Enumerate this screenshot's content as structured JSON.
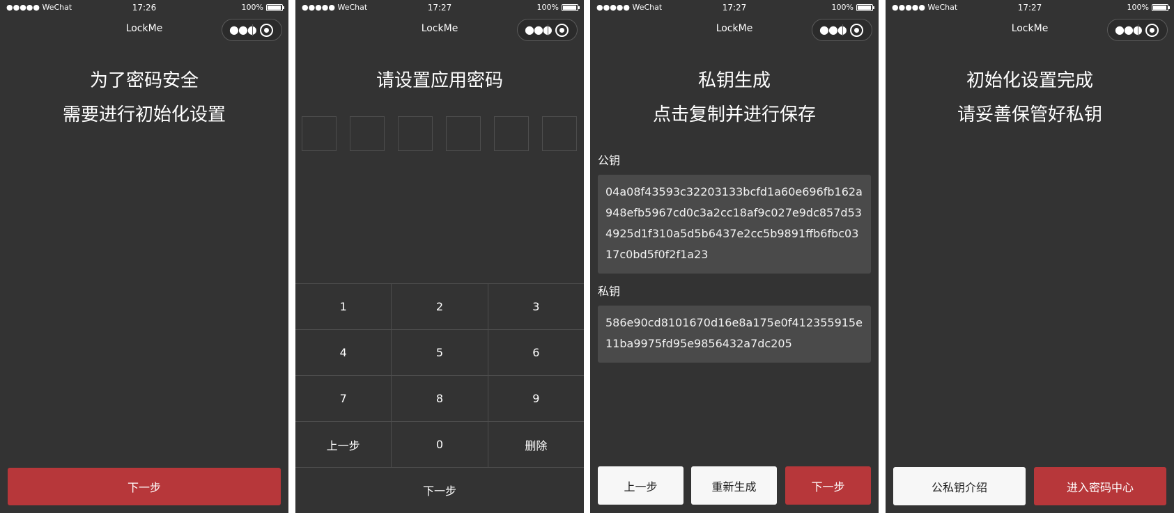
{
  "status": {
    "signal": "●●●●● WeChat",
    "battery": "100%"
  },
  "app_title": "LockMe",
  "capsule": {
    "more_icon": "●●●"
  },
  "screen1": {
    "time": "17:26",
    "line1": "为了密码安全",
    "line2": "需要进行初始化设置",
    "next_button": "下一步"
  },
  "screen2": {
    "time": "17:27",
    "headline": "请设置应用密码",
    "keypad": {
      "rows": [
        [
          "1",
          "2",
          "3"
        ],
        [
          "4",
          "5",
          "6"
        ],
        [
          "7",
          "8",
          "9"
        ],
        [
          "上一步",
          "0",
          "删除"
        ]
      ]
    },
    "next_button": "下一步"
  },
  "screen3": {
    "time": "17:27",
    "line1": "私钥生成",
    "line2": "点击复制并进行保存",
    "public_key_label": "公钥",
    "public_key": "04a08f43593c32203133bcfd1a60e696fb162a948efb5967cd0c3a2cc18af9c027e9dc857d534925d1f310a5d5b6437e2cc5b9891ffb6fbc0317c0bd5f0f2f1a23",
    "private_key_label": "私钥",
    "private_key": "586e90cd8101670d16e8a175e0f412355915e11ba9975fd95e9856432a7dc205",
    "prev_button": "上一步",
    "regen_button": "重新生成",
    "next_button": "下一步"
  },
  "screen4": {
    "time": "17:27",
    "line1": "初始化设置完成",
    "line2": "请妥善保管好私钥",
    "intro_button": "公私钥介绍",
    "enter_button": "进入密码中心"
  },
  "colors": {
    "background": "#333333",
    "accent_red": "#b7373a",
    "key_box": "#4a4a4a",
    "white_button": "#f7f7f7"
  }
}
